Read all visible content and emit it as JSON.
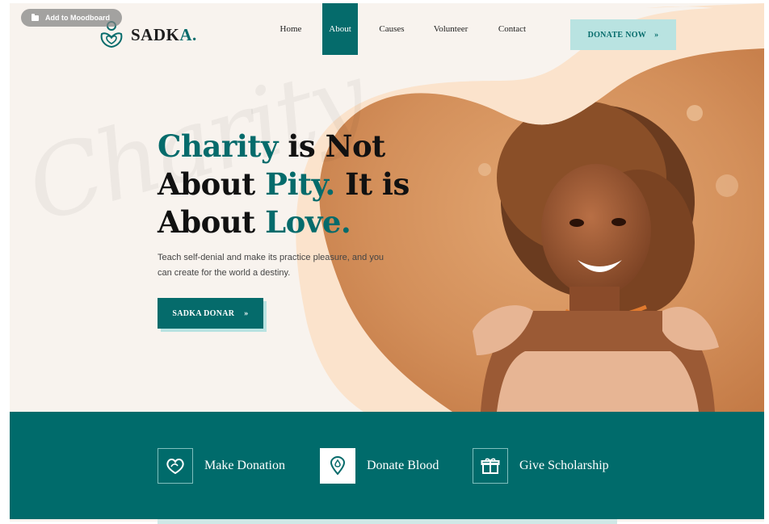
{
  "overlay": {
    "moodboard_label": "Add to Moodboard"
  },
  "header": {
    "brand_main": "SADK",
    "brand_accent": "A.",
    "nav": [
      {
        "label": "Home",
        "active": false
      },
      {
        "label": "About",
        "active": true
      },
      {
        "label": "Causes",
        "active": false
      },
      {
        "label": "Volunteer",
        "active": false
      },
      {
        "label": "Contact",
        "active": false
      }
    ],
    "donate_button": "DONATE NOW",
    "donate_arrow": "»"
  },
  "hero": {
    "watermark": "Charity",
    "headline": {
      "l1a": "Charity",
      "l1b": " is Not",
      "l2a": "About ",
      "l2b": "Pity.",
      "l2c": " It is",
      "l3a": "About ",
      "l3b": "Love."
    },
    "subtext": "Teach self-denial and make its practice pleasure, and you can create for the world a destiny.",
    "cta_label": "SADKA DONAR",
    "cta_arrow": "»"
  },
  "services": [
    {
      "label": "Make Donation",
      "icon": "heart-leaf-icon"
    },
    {
      "label": "Donate Blood",
      "icon": "blood-pin-icon"
    },
    {
      "label": "Give Scholarship",
      "icon": "gift-icon"
    }
  ],
  "colors": {
    "primary": "#056b6b",
    "accent": "#b9e3e1",
    "background": "#f8f3ee",
    "band": "#006b6b"
  }
}
